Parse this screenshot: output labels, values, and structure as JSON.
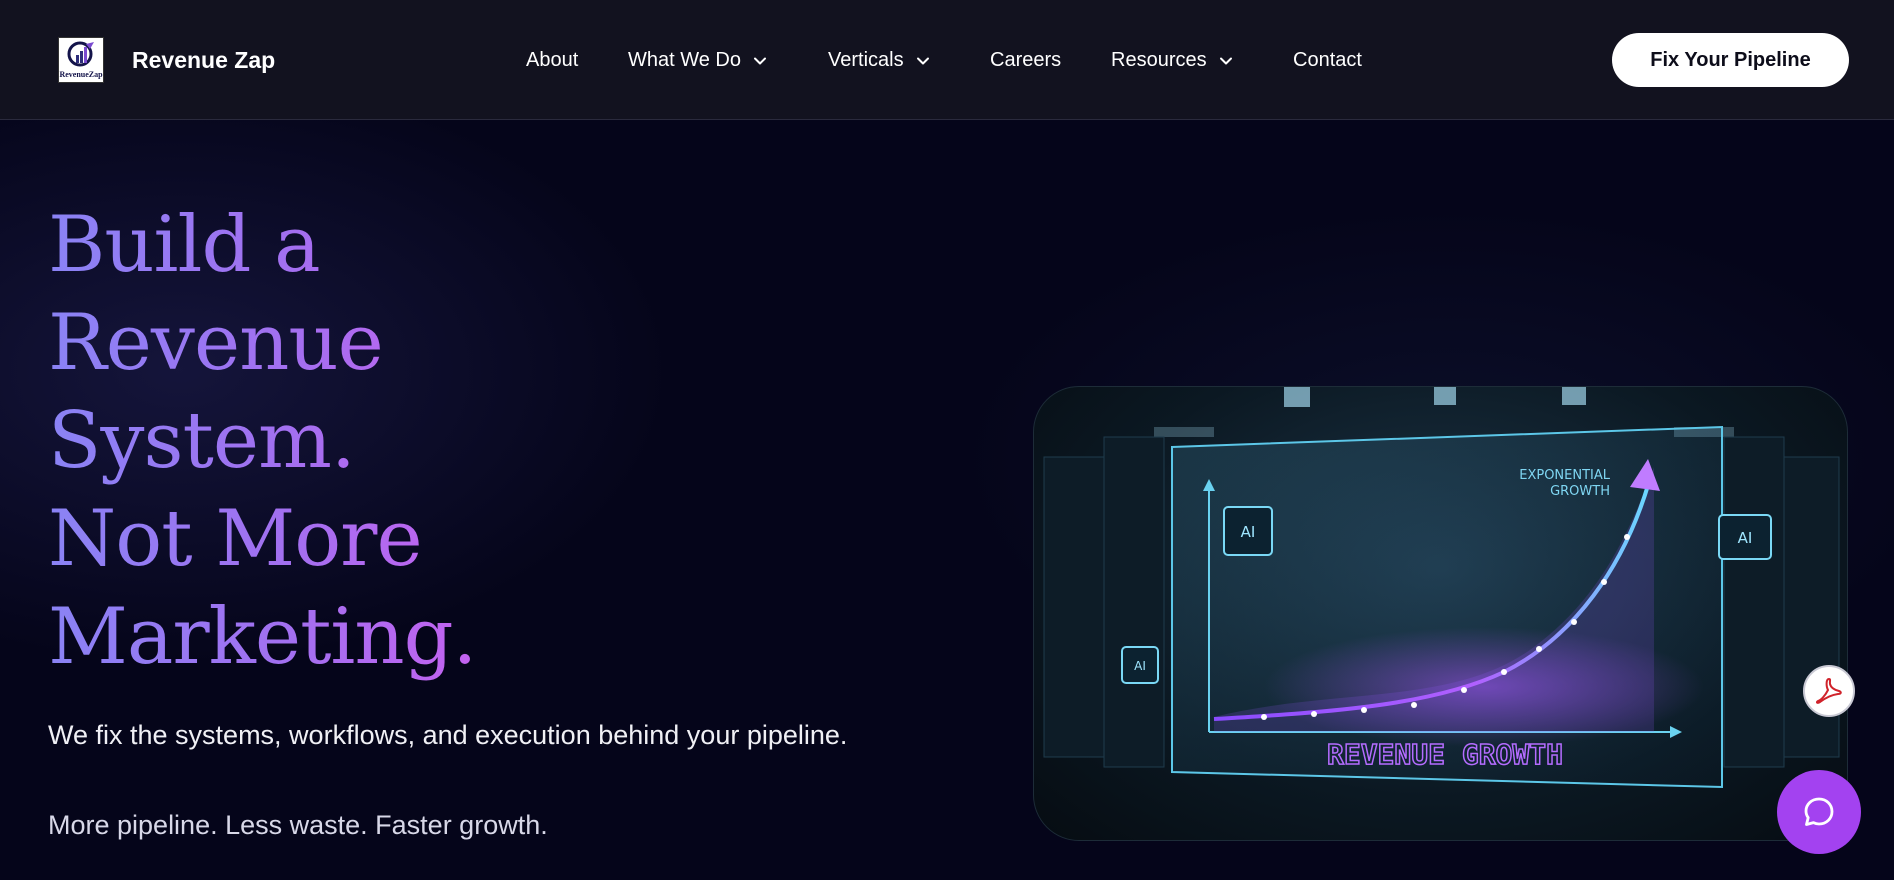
{
  "brand": {
    "name": "Revenue Zap",
    "logo_text": "RevenueZap"
  },
  "nav": {
    "items": [
      {
        "label": "About",
        "has_dropdown": false
      },
      {
        "label": "What We Do",
        "has_dropdown": true
      },
      {
        "label": "Verticals",
        "has_dropdown": true
      },
      {
        "label": "Careers",
        "has_dropdown": false
      },
      {
        "label": "Resources",
        "has_dropdown": true
      },
      {
        "label": "Contact",
        "has_dropdown": false
      }
    ],
    "cta_label": "Fix Your Pipeline"
  },
  "hero": {
    "title_lines": [
      "Build a",
      "Revenue",
      "System.",
      "Not More",
      "Marketing."
    ],
    "subtitle": "We fix the systems, workflows, and execution behind your pipeline.",
    "tagline": "More pipeline. Less waste. Faster growth.",
    "image": {
      "chip_label": "AI",
      "growth_label_line1": "EXPONENTIAL",
      "growth_label_line2": "GROWTH",
      "caption": "REVENUE GROWTH"
    }
  },
  "icons": {
    "pdf": "pdf-icon",
    "chat": "chat-bubble-icon",
    "chevron": "chevron-down-icon"
  },
  "colors": {
    "background": "#05051a",
    "header": "#12121f",
    "title_gradient_start": "#8a83f5",
    "title_gradient_end": "#d26df3",
    "chat_button": "#a342f0",
    "pdf_red": "#d0232b"
  }
}
